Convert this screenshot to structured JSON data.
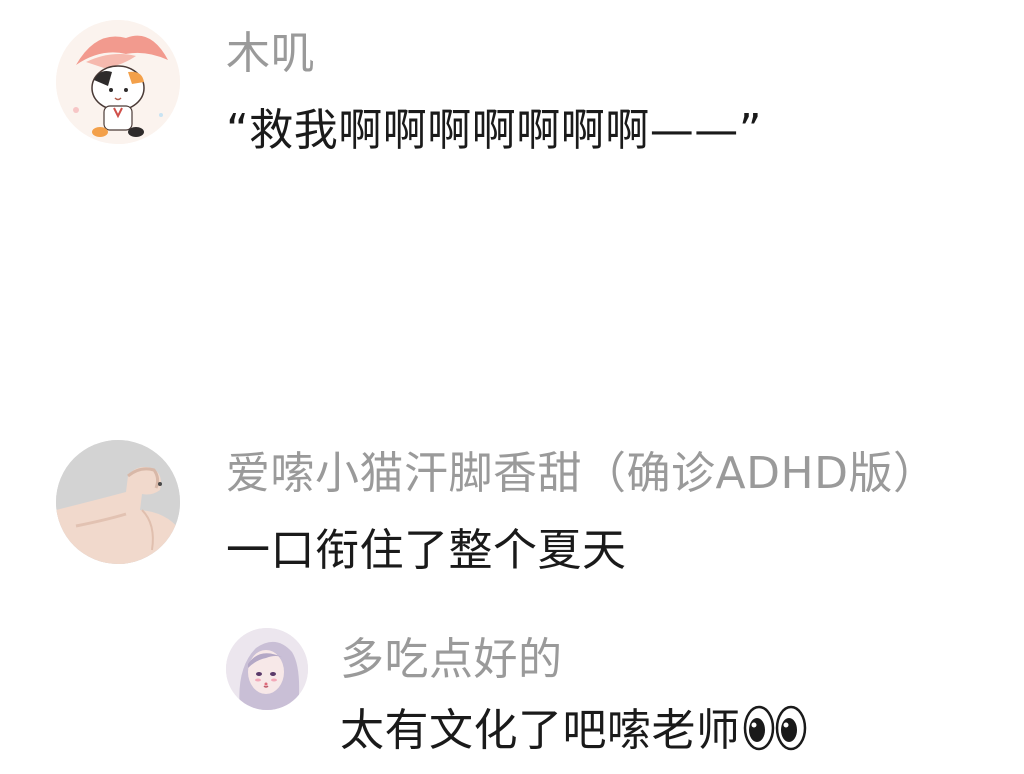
{
  "comments": [
    {
      "username": "木叽",
      "text": "“救我啊啊啊啊啊啊啊——”",
      "avatar": "cat-girl-avatar"
    },
    {
      "username": "爱嗦小猫汗脚香甜（确诊ADHD版）",
      "text": "一口衔住了整个夏天",
      "avatar": "flexed-arm-avatar"
    }
  ],
  "reply": {
    "username": "多吃点好的",
    "text": "太有文化了吧嗦老师",
    "emoji": "eyes-emoji",
    "avatar": "anime-girl-avatar"
  },
  "colors": {
    "username": "#9a9a9a",
    "text": "#1a1a1a",
    "background": "#ffffff"
  }
}
